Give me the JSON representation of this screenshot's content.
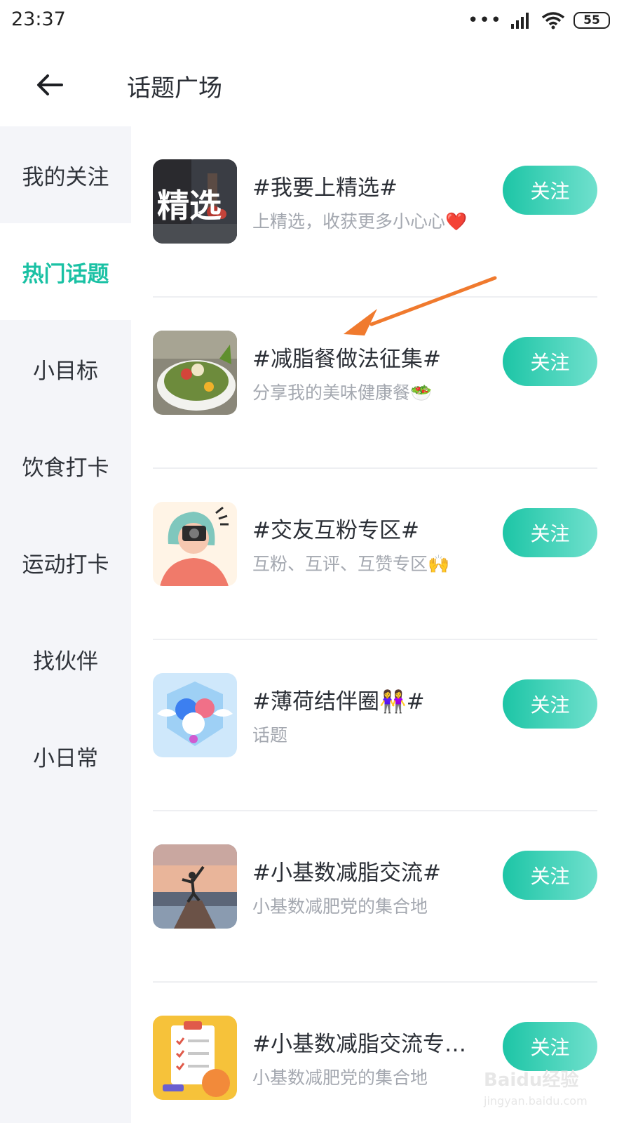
{
  "status_bar": {
    "time": "23:37",
    "battery": "55"
  },
  "header": {
    "title": "话题广场"
  },
  "sidebar": {
    "items": [
      {
        "label": "我的关注",
        "active": false
      },
      {
        "label": "热门话题",
        "active": true
      },
      {
        "label": "小目标",
        "active": false
      },
      {
        "label": "饮食打卡",
        "active": false
      },
      {
        "label": "运动打卡",
        "active": false
      },
      {
        "label": "找伙伴",
        "active": false
      },
      {
        "label": "小日常",
        "active": false
      }
    ]
  },
  "topics": [
    {
      "title": "#我要上精选#",
      "desc": "上精选，收获更多小心心❤️",
      "button": "关注",
      "thumb_text": "精选"
    },
    {
      "title": "#减脂餐做法征集#",
      "desc": "分享我的美味健康餐🥗",
      "button": "关注"
    },
    {
      "title": "#交友互粉专区#",
      "desc": "互粉、互评、互赞专区🙌",
      "button": "关注"
    },
    {
      "title": "#薄荷结伴圈👭#",
      "desc": "话题",
      "button": "关注"
    },
    {
      "title": "#小基数减脂交流#",
      "desc": "小基数减肥党的集合地",
      "button": "关注"
    },
    {
      "title": "#小基数减脂交流专…",
      "desc": "小基数减肥党的集合地",
      "button": "关注"
    }
  ],
  "watermark": {
    "brand": "Baidu经验",
    "url": "jingyan.baidu.com"
  },
  "colors": {
    "accent": "#1ac1a4",
    "annotation": "#f07a2e",
    "sidebar_bg": "#f4f5f9"
  }
}
